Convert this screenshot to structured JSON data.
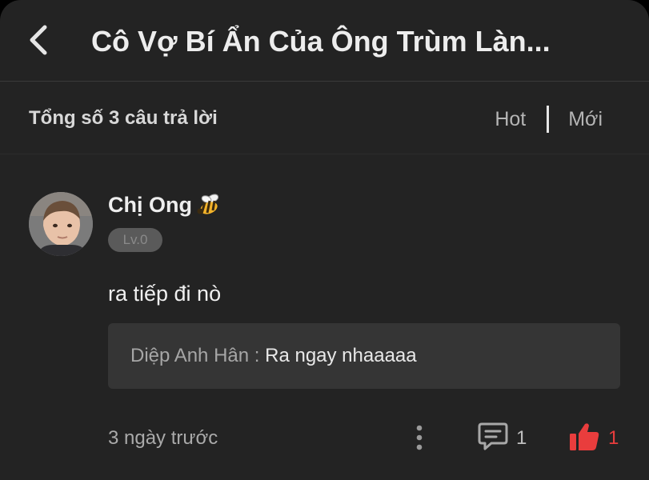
{
  "header": {
    "title": "Cô Vợ Bí Ẩn Của Ông Trùm Làn..."
  },
  "answers": {
    "count_label": "Tổng số 3 câu trả lời",
    "sort_options": [
      "Hot",
      "Mới"
    ]
  },
  "comment": {
    "user_name": "Chị Ong",
    "level": "Lv.0",
    "text": "ra tiếp đi nò",
    "reply": {
      "author": "Diệp Anh Hân",
      "separator": " : ",
      "text": "Ra ngay nhaaaaa"
    },
    "time": "3 ngày trước",
    "reply_count": "1",
    "like_count": "1"
  },
  "icons": {
    "back": "chevron-left-icon",
    "bee": "bee-icon",
    "more": "more-vertical-icon",
    "comment": "comment-bubble-icon",
    "like": "thumbs-up-icon"
  },
  "colors": {
    "background": "#232323",
    "like_accent": "#e93d3d",
    "reply_box": "#353535"
  }
}
